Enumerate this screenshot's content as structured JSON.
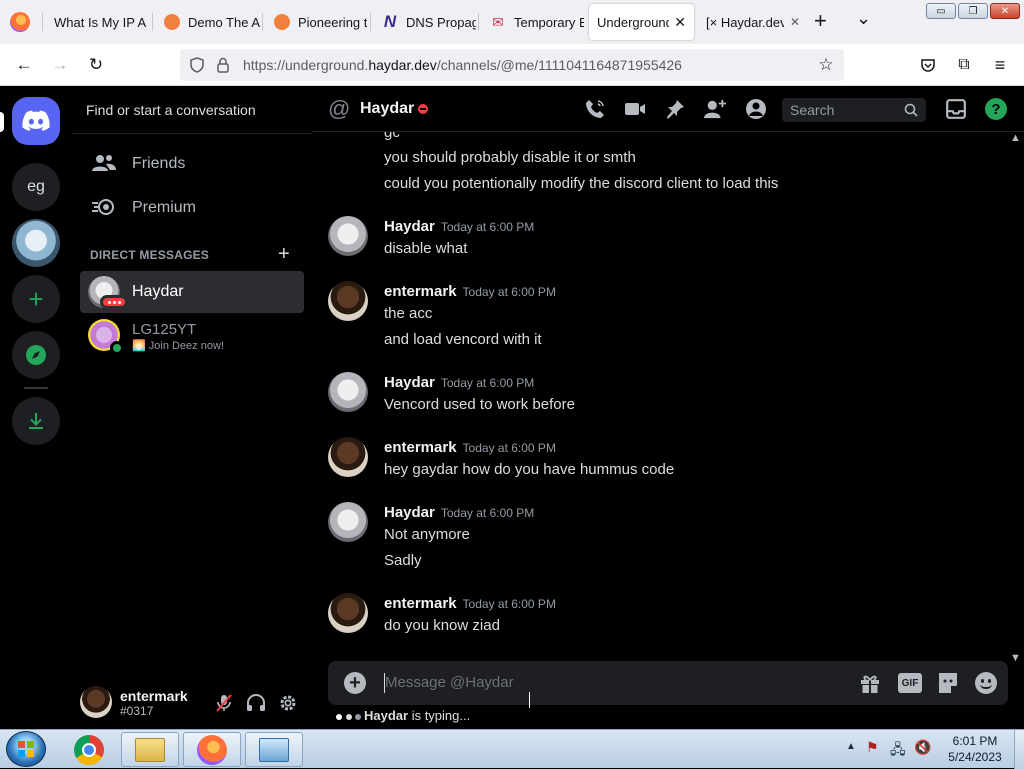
{
  "browser": {
    "tabs": [
      {
        "title": "What Is My IP A",
        "favicon_color": "#e66000",
        "favicon_glyph": ""
      },
      {
        "title": "Demo The A",
        "favicon_color": "#f0803c",
        "favicon_glyph": ""
      },
      {
        "title": "Pioneering t",
        "favicon_color": "#f0803c",
        "favicon_glyph": ""
      },
      {
        "title": "DNS Propag",
        "favicon_color": "#3b2a8a",
        "favicon_glyph": "N"
      },
      {
        "title": "Temporary E",
        "favicon_color": "#c8374a",
        "favicon_glyph": "✉"
      },
      {
        "title": "Underground",
        "favicon_color": "",
        "favicon_glyph": "",
        "active": true
      },
      {
        "title": "[× Haydar.dev",
        "favicon_color": "",
        "favicon_glyph": ""
      }
    ],
    "new_tab": "+",
    "tab_list": "⌄",
    "window_controls": {
      "minimize": "▭",
      "restore": "❐",
      "close": "✕"
    },
    "url_prefix": "https://underground.",
    "url_domain": "haydar.dev",
    "url_path": "/channels/@me/1111041164871955426"
  },
  "discord": {
    "guilds": {
      "home_icon": "discord-logo-icon",
      "server_eg": "eg",
      "add_server": "+",
      "explore": "compass-icon",
      "download": "download-icon"
    },
    "dm": {
      "search_placeholder": "Find or start a conversation",
      "friends": "Friends",
      "premium": "Premium",
      "direct_messages": "DIRECT MESSAGES",
      "add_dm": "+",
      "conversations": [
        {
          "name": "Haydar",
          "status": "",
          "selected": true
        },
        {
          "name": "LG125YT",
          "status": "🌅 Join Deez now!"
        }
      ]
    },
    "user_panel": {
      "username": "entermark",
      "tag": "#0317"
    },
    "chat": {
      "recipient": "Haydar",
      "search_placeholder": "Search",
      "messages": [
        {
          "author": "",
          "time": "",
          "lines": [
            "gc",
            "you should probably disable it or smth",
            "could you potentionally modify the discord client to load this"
          ],
          "continuation": true
        },
        {
          "author": "Haydar",
          "time": "Today at 6:00 PM",
          "lines": [
            "disable what"
          ]
        },
        {
          "author": "entermark",
          "time": "Today at 6:00 PM",
          "lines": [
            "the acc",
            "and load vencord with it"
          ]
        },
        {
          "author": "Haydar",
          "time": "Today at 6:00 PM",
          "lines": [
            "Vencord used to work before"
          ]
        },
        {
          "author": "entermark",
          "time": "Today at 6:00 PM",
          "lines": [
            "hey gaydar how do you have hummus code"
          ]
        },
        {
          "author": "Haydar",
          "time": "Today at 6:00 PM",
          "lines": [
            "Not anymore",
            "Sadly"
          ]
        },
        {
          "author": "entermark",
          "time": "Today at 6:00 PM",
          "lines": [
            "do you know ziad"
          ]
        }
      ],
      "composer_placeholder": "Message @Haydar",
      "typing_user": "Haydar",
      "typing_text": " is typing...",
      "gif_label": "GIF"
    }
  },
  "taskbar": {
    "clock_time": "6:01 PM",
    "clock_date": "5/24/2023"
  },
  "colors": {
    "discord_blurple": "#5865f2",
    "green": "#23a55a",
    "dnd_red": "#f23f43",
    "help_green": "#23a55a"
  }
}
